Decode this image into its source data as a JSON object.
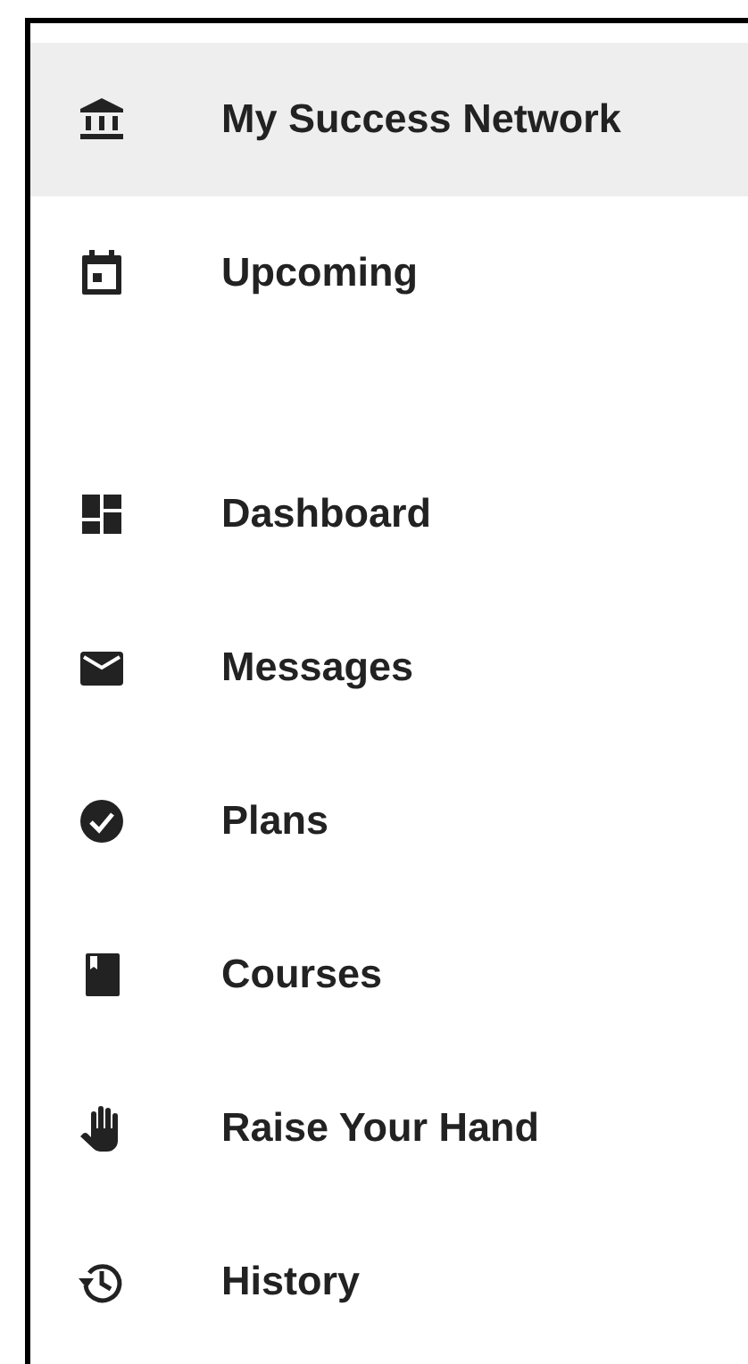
{
  "sections": [
    {
      "items": [
        {
          "label": "My Success Network",
          "selected": true
        },
        {
          "label": "Upcoming",
          "selected": false
        }
      ]
    },
    {
      "items": [
        {
          "label": "Dashboard",
          "selected": false
        },
        {
          "label": "Messages",
          "selected": false
        },
        {
          "label": "Plans",
          "selected": false
        },
        {
          "label": "Courses",
          "selected": false
        },
        {
          "label": "Raise Your Hand",
          "selected": false
        },
        {
          "label": "History",
          "selected": false
        }
      ]
    }
  ]
}
